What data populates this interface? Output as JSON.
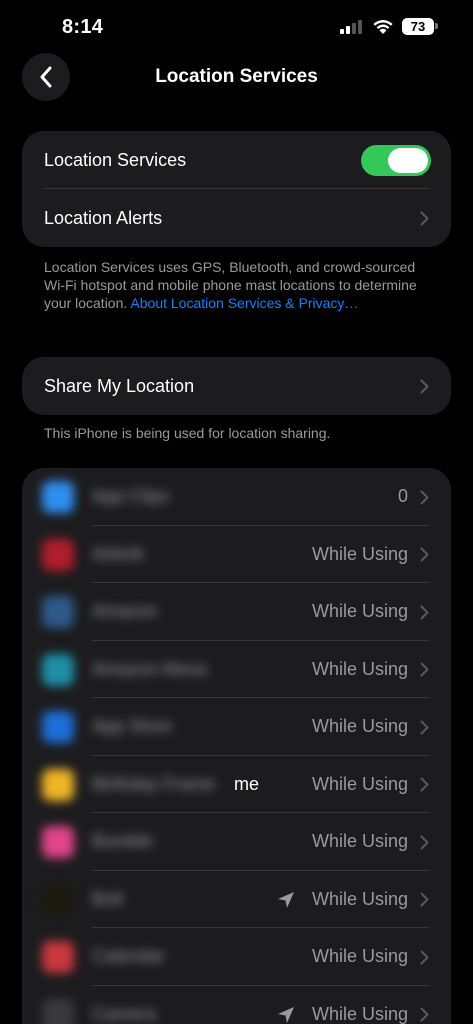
{
  "status_bar": {
    "time": "8:14",
    "battery": "73"
  },
  "nav": {
    "title": "Location Services"
  },
  "main_toggle": {
    "label": "Location Services",
    "on": true
  },
  "alerts": {
    "label": "Location Alerts"
  },
  "description": {
    "text": "Location Services uses GPS, Bluetooth, and crowd-sourced Wi-Fi hotspot and mobile phone mast locations to determine your location.",
    "link": "About Location Services & Privacy…"
  },
  "share": {
    "label": "Share My Location",
    "note": "This iPhone is being used for location sharing."
  },
  "apps": [
    {
      "name": "App Clips",
      "value": "0",
      "icon_color": "#2f8ef0",
      "arrow": false
    },
    {
      "name": "Airbnb",
      "value": "While Using",
      "icon_color": "#b01e2c",
      "arrow": false
    },
    {
      "name": "Amazon",
      "value": "While Using",
      "icon_color": "#2e5a8a",
      "arrow": false
    },
    {
      "name": "Amazon Alexa",
      "value": "While Using",
      "icon_color": "#1f8fa8",
      "arrow": false
    },
    {
      "name": "App Store",
      "value": "While Using",
      "icon_color": "#1e6ed8",
      "arrow": false
    },
    {
      "name": "Birthday Frame",
      "value": "While Using",
      "icon_color": "#f0b429",
      "arrow": false,
      "visible_suffix": "me"
    },
    {
      "name": "Bumble",
      "value": "While Using",
      "icon_color": "#e2458a",
      "arrow": false
    },
    {
      "name": "Bolt",
      "value": "While Using",
      "icon_color": "#1a1a10",
      "arrow": true
    },
    {
      "name": "Calendar",
      "value": "While Using",
      "icon_color": "#c8383f",
      "arrow": false
    },
    {
      "name": "Camera",
      "value": "While Using",
      "icon_color": "#3a3a3c",
      "arrow": true
    }
  ],
  "colors": {
    "accent": "#0a84ff",
    "toggle_on": "#34c759",
    "card": "#1c1c1e"
  }
}
